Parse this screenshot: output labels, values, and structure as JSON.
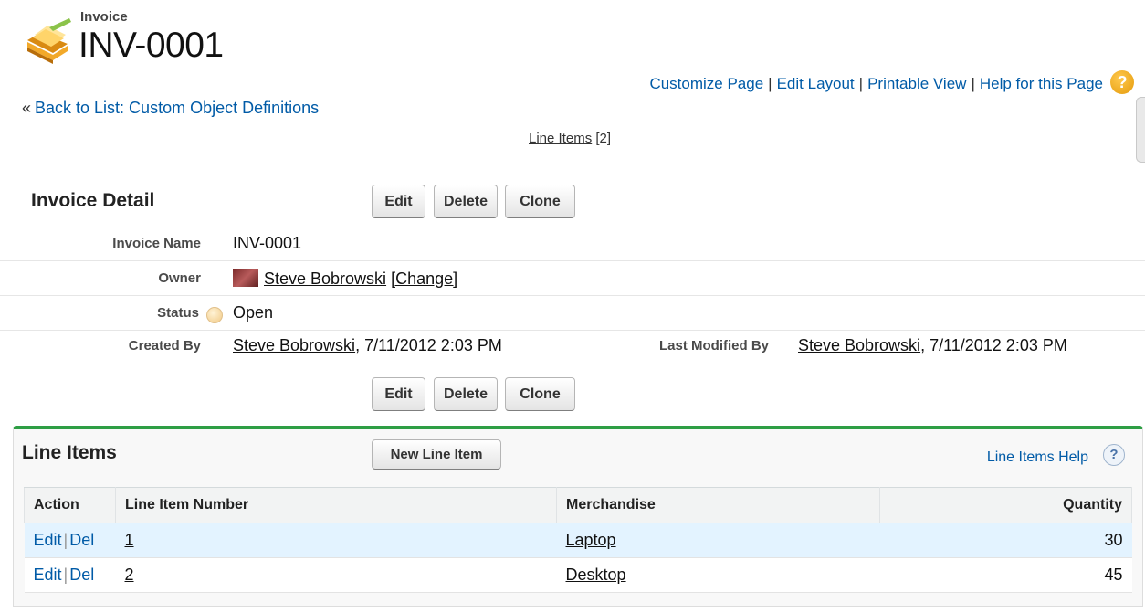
{
  "header": {
    "object_label": "Invoice",
    "record_title": "INV-0001",
    "icon": "folder-invoice-icon"
  },
  "top_links": {
    "customize": "Customize Page",
    "edit_layout": "Edit Layout",
    "printable": "Printable View",
    "help": "Help for this Page",
    "separator": "|",
    "help_icon": "?"
  },
  "back_link": {
    "prefix": "«",
    "label": "Back to List: Custom Object Definitions"
  },
  "related_hover": {
    "label": "Line Items",
    "count": "[2]"
  },
  "detail": {
    "title": "Invoice Detail",
    "buttons": {
      "edit": "Edit",
      "delete": "Delete",
      "clone": "Clone"
    },
    "fields": {
      "invoice_name_label": "Invoice Name",
      "invoice_name_value": "INV-0001",
      "owner_label": "Owner",
      "owner_name": "Steve Bobrowski",
      "owner_change": "[Change]",
      "status_label": "Status",
      "status_value": "Open",
      "created_by_label": "Created By",
      "created_by_name": "Steve Bobrowski",
      "created_by_date": ", 7/11/2012 2:03 PM",
      "modified_by_label": "Last Modified By",
      "modified_by_name": "Steve Bobrowski",
      "modified_by_date": ", 7/11/2012 2:03 PM"
    }
  },
  "line_items": {
    "title": "Line Items",
    "new_button": "New Line Item",
    "help_label": "Line Items Help",
    "help_icon": "?",
    "columns": [
      "Action",
      "Line Item Number",
      "Merchandise",
      "Quantity"
    ],
    "action_edit": "Edit",
    "action_del": "Del",
    "action_sep": "|",
    "rows": [
      {
        "number": "1",
        "merchandise": "Laptop",
        "quantity": "30"
      },
      {
        "number": "2",
        "merchandise": "Desktop",
        "quantity": "45"
      }
    ]
  },
  "colors": {
    "link": "#015ba7",
    "related_list_accent": "#2e9e44",
    "row_highlight": "#e3f3ff"
  }
}
